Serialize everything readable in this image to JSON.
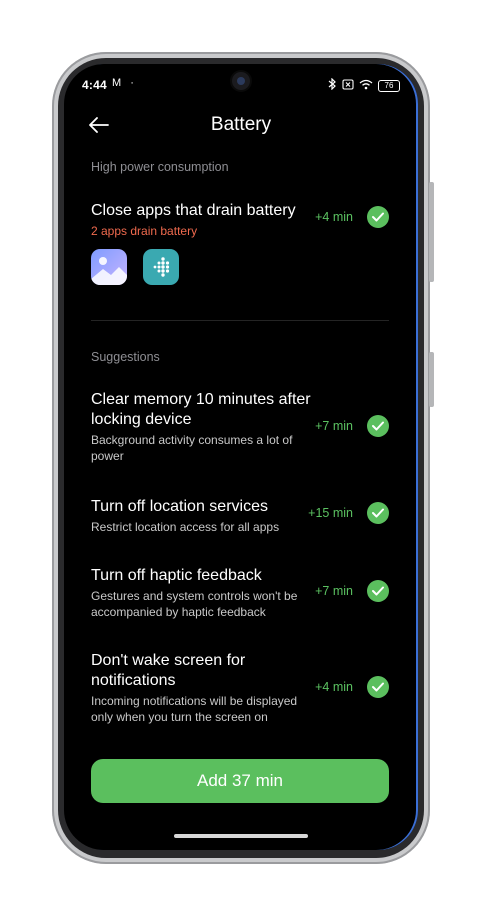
{
  "status_bar": {
    "time": "4:44",
    "battery_level": "76"
  },
  "header": {
    "title": "Battery"
  },
  "high_power": {
    "label": "High power consumption",
    "item": {
      "title": "Close apps that drain battery",
      "subtitle": "2 apps drain battery",
      "gain": "+4 min",
      "apps": [
        "gallery-icon",
        "fitbit-icon"
      ]
    }
  },
  "suggestions": {
    "label": "Suggestions",
    "items": [
      {
        "title": "Clear memory 10 minutes after locking device",
        "subtitle": "Background activity consumes a lot of power",
        "gain": "+7 min"
      },
      {
        "title": "Turn off location services",
        "subtitle": "Restrict location access for all apps",
        "gain": "+15 min"
      },
      {
        "title": "Turn off haptic feedback",
        "subtitle": "Gestures and system controls won't be accompanied by haptic feedback",
        "gain": "+7 min"
      },
      {
        "title": "Don't wake screen for notifications",
        "subtitle": "Incoming notifications will be displayed only when you turn the screen on",
        "gain": "+4 min"
      }
    ]
  },
  "cta": {
    "label": "Add 37 min"
  },
  "colors": {
    "accent": "#5bbf5e",
    "warning": "#f06a4e",
    "background": "#000000"
  }
}
